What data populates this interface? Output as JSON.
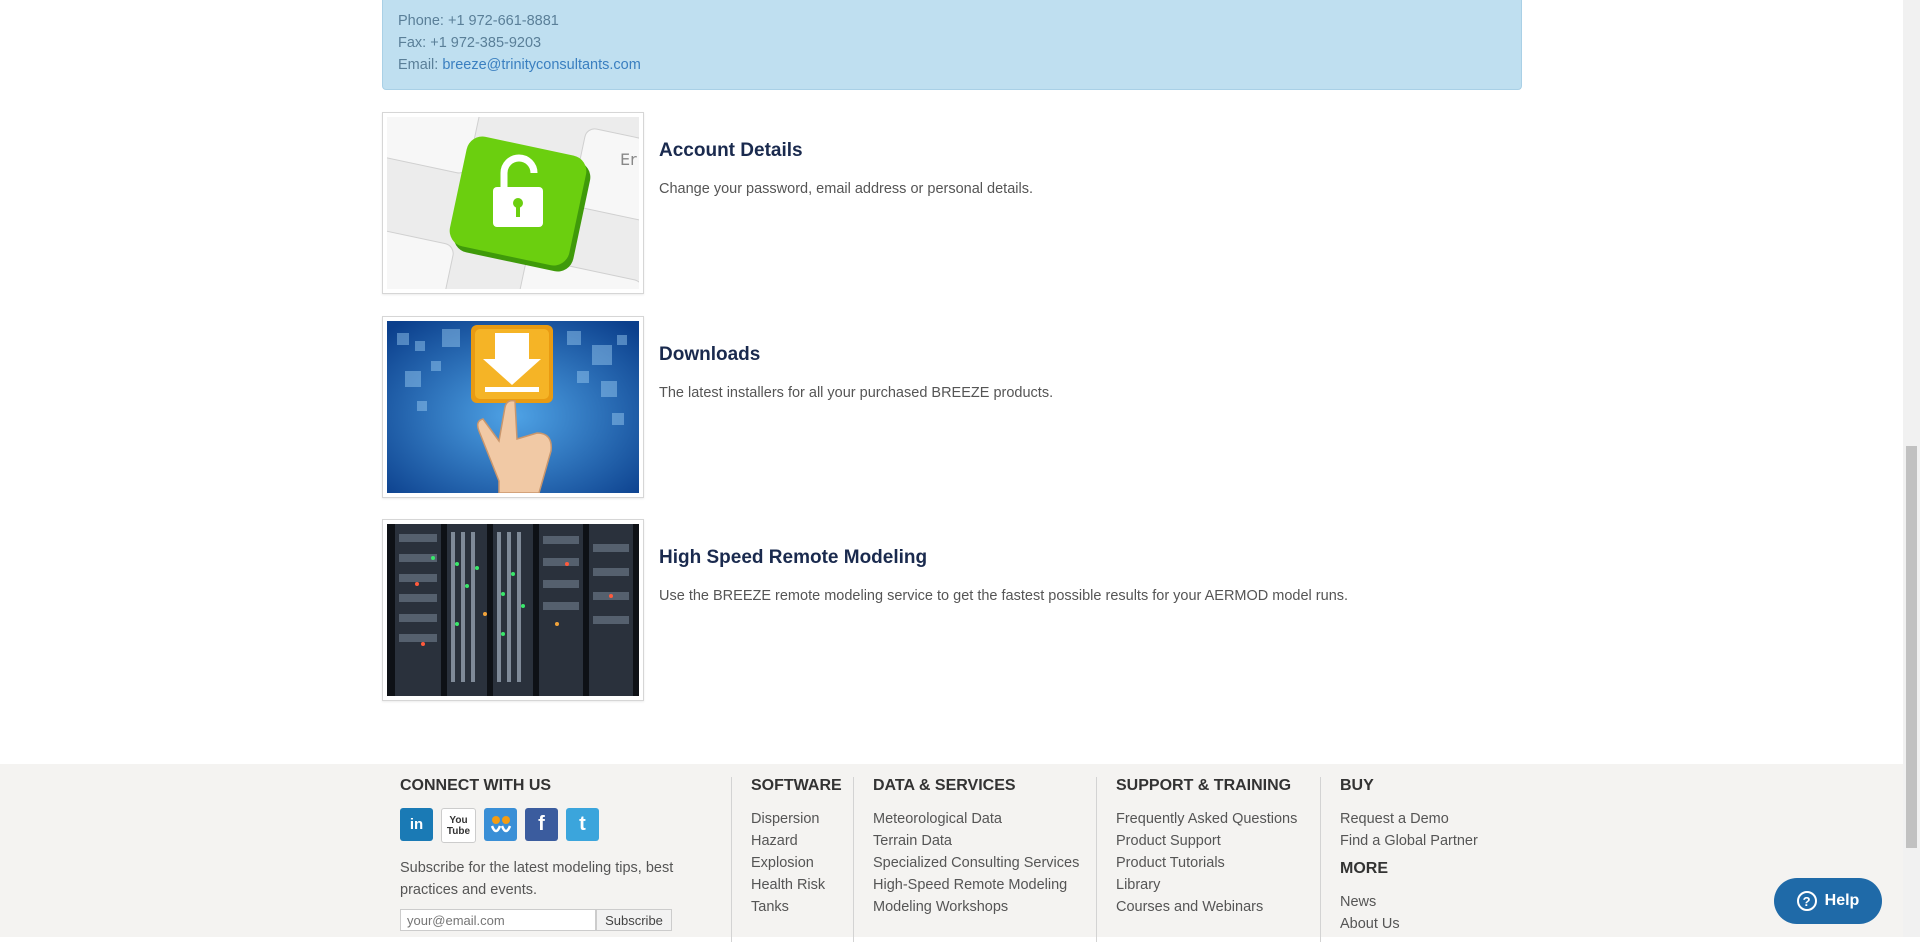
{
  "contact": {
    "phone": "Phone: +1 972-661-8881",
    "fax": "Fax: +1 972-385-9203",
    "email_label": "Email: ",
    "email": "breeze@trinityconsultants.com"
  },
  "cards": [
    {
      "title": "Account Details",
      "description": "Change your password, email address or personal details."
    },
    {
      "title": "Downloads",
      "description": "The latest installers for all your purchased BREEZE products."
    },
    {
      "title": "High Speed Remote Modeling",
      "description": "Use the BREEZE remote modeling service to get the fastest possible results for your AERMOD model runs."
    }
  ],
  "footer": {
    "connect": {
      "heading": "CONNECT WITH US",
      "social": [
        "in",
        "You Tube",
        "slideshare",
        "f",
        "t"
      ],
      "subscribe_text": "Subscribe for the latest modeling tips, best practices and events.",
      "email_placeholder": "your@email.com",
      "subscribe_button": "Subscribe"
    },
    "software": {
      "heading": "SOFTWARE",
      "links": [
        "Dispersion",
        "Hazard",
        "Explosion",
        "Health Risk",
        "Tanks"
      ]
    },
    "data_services": {
      "heading": "DATA & SERVICES",
      "links": [
        "Meteorological Data",
        "Terrain Data",
        "Specialized Consulting Services",
        "High-Speed Remote Modeling",
        "Modeling Workshops"
      ]
    },
    "support": {
      "heading": "SUPPORT & TRAINING",
      "links": [
        "Frequently Asked Questions",
        "Product Support",
        "Product Tutorials",
        "Library",
        "Courses and Webinars"
      ]
    },
    "buy": {
      "heading": "BUY",
      "links": [
        "Request a Demo",
        "Find a Global Partner"
      ]
    },
    "more": {
      "heading": "MORE",
      "links": [
        "News",
        "About Us"
      ]
    }
  },
  "help_button": "Help",
  "colors": {
    "contact_bg": "#bfdff0",
    "title": "#1a2a4e",
    "footer_bg": "#f4f3f1",
    "help_bg": "#1f6aa8"
  }
}
